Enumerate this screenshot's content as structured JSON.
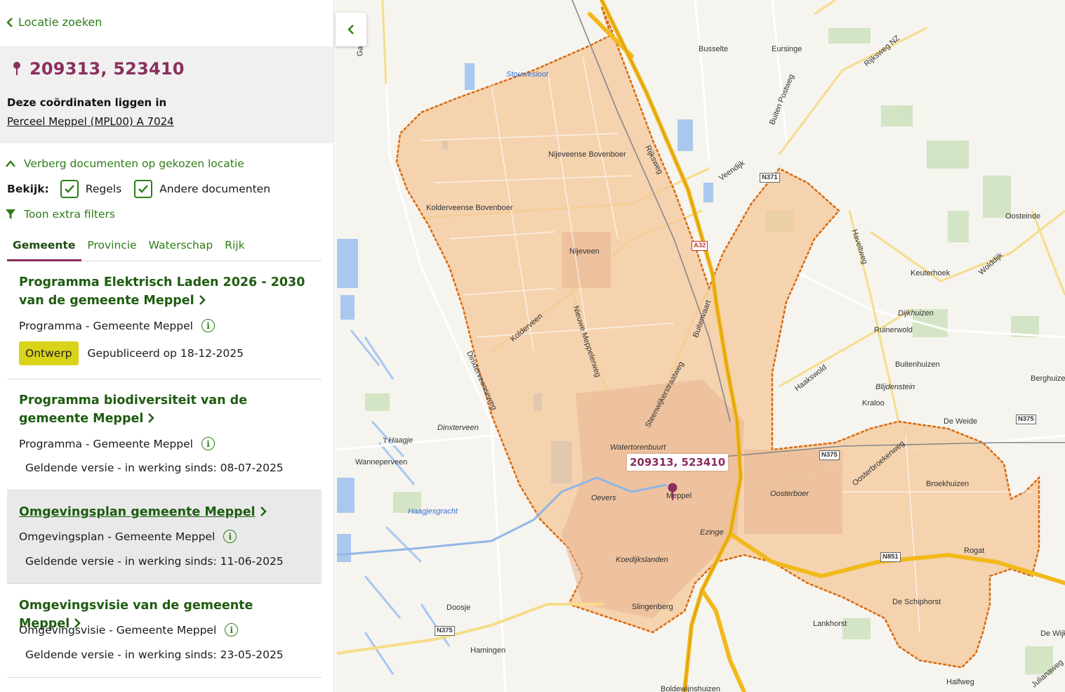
{
  "sidebar": {
    "back_link": "Locatie zoeken",
    "coordinates": "209313, 523410",
    "location_intro": "Deze coördinaten liggen in",
    "parcel": "Perceel Meppel (MPL00) A 7024",
    "toggle_documents": "Verberg documenten op gekozen locatie",
    "view_label": "Bekijk:",
    "checkbox_rules": "Regels",
    "checkbox_other": "Andere documenten",
    "extra_filters": "Toon extra filters",
    "tabs": [
      "Gemeente",
      "Provincie",
      "Waterschap",
      "Rijk"
    ],
    "active_tab": "Gemeente",
    "documents": [
      {
        "title": "Programma Elektrisch Laden 2026 - 2030 van de gemeente Meppel",
        "type": "Programma - Gemeente Meppel",
        "badge": "Ontwerp",
        "status": "Gepubliceerd op 18-12-2025"
      },
      {
        "title": "Programma biodiversiteit van de gemeente Meppel",
        "type": "Programma - Gemeente Meppel",
        "status": "Geldende versie - in werking sinds: 08-07-2025"
      },
      {
        "title": "Omgevingsplan gemeente Meppel",
        "type": "Omgevingsplan - Gemeente Meppel",
        "status": "Geldende versie - in werking sinds: 11-06-2025"
      },
      {
        "title": "Omgevingsvisie van de gemeente Meppel",
        "type": "Omgevingsvisie - Gemeente Meppel",
        "status": "Geldende versie - in werking sinds: 23-05-2025"
      }
    ]
  },
  "map": {
    "popup": "209313, 523410",
    "places": [
      "Busselte",
      "Eursinge",
      "Stouwesloot",
      "Nijeveense Bovenboer",
      "Kolderveense Bovenboer",
      "Nijeveen",
      "Oosteinde",
      "Keuterhoek",
      "Dijkhuizen",
      "Ruinerwold",
      "Buitenhuizen",
      "Blijdenstein",
      "Kraloo",
      "Berghuizen",
      "De Weide",
      "Broekhuizen",
      "Dinxterveen",
      "'t Haagje",
      "Wanneperveen",
      "Watertorenbuurt",
      "Oevers",
      "Meppel",
      "Oosterboer",
      "Ezinge",
      "Koedijkslanden",
      "Haagjesgracht",
      "Slingenberg",
      "Rogat",
      "De Schiphorst",
      "Lankhorst",
      "Doosje",
      "Hamingen",
      "Boldewijnshuizen",
      "Halfweg",
      "De Wijk"
    ],
    "roads": [
      "Gasthuisdijk",
      "Rijksweg",
      "Buiten Postweg",
      "Veendijk",
      "Rijksweg NZ",
      "Haveltweg",
      "Wolddijk",
      "Kolderveen",
      "Nieuwe Meppelerweg",
      "Buitenvaart",
      "Steenwijkerstraatweg",
      "Haakswold",
      "Oosterbroekenweg",
      "Dinxterveenseweg",
      "Julianaweg"
    ],
    "shields": [
      "A32",
      "N371",
      "N375",
      "N375",
      "N851",
      "N375",
      "N375"
    ],
    "colors": {
      "boundary_fill": "#f4c89a",
      "boundary_stroke": "#d96a0e",
      "highway": "#f2b91c",
      "accent": "#8a2f5c",
      "link": "#2e7d17"
    }
  }
}
